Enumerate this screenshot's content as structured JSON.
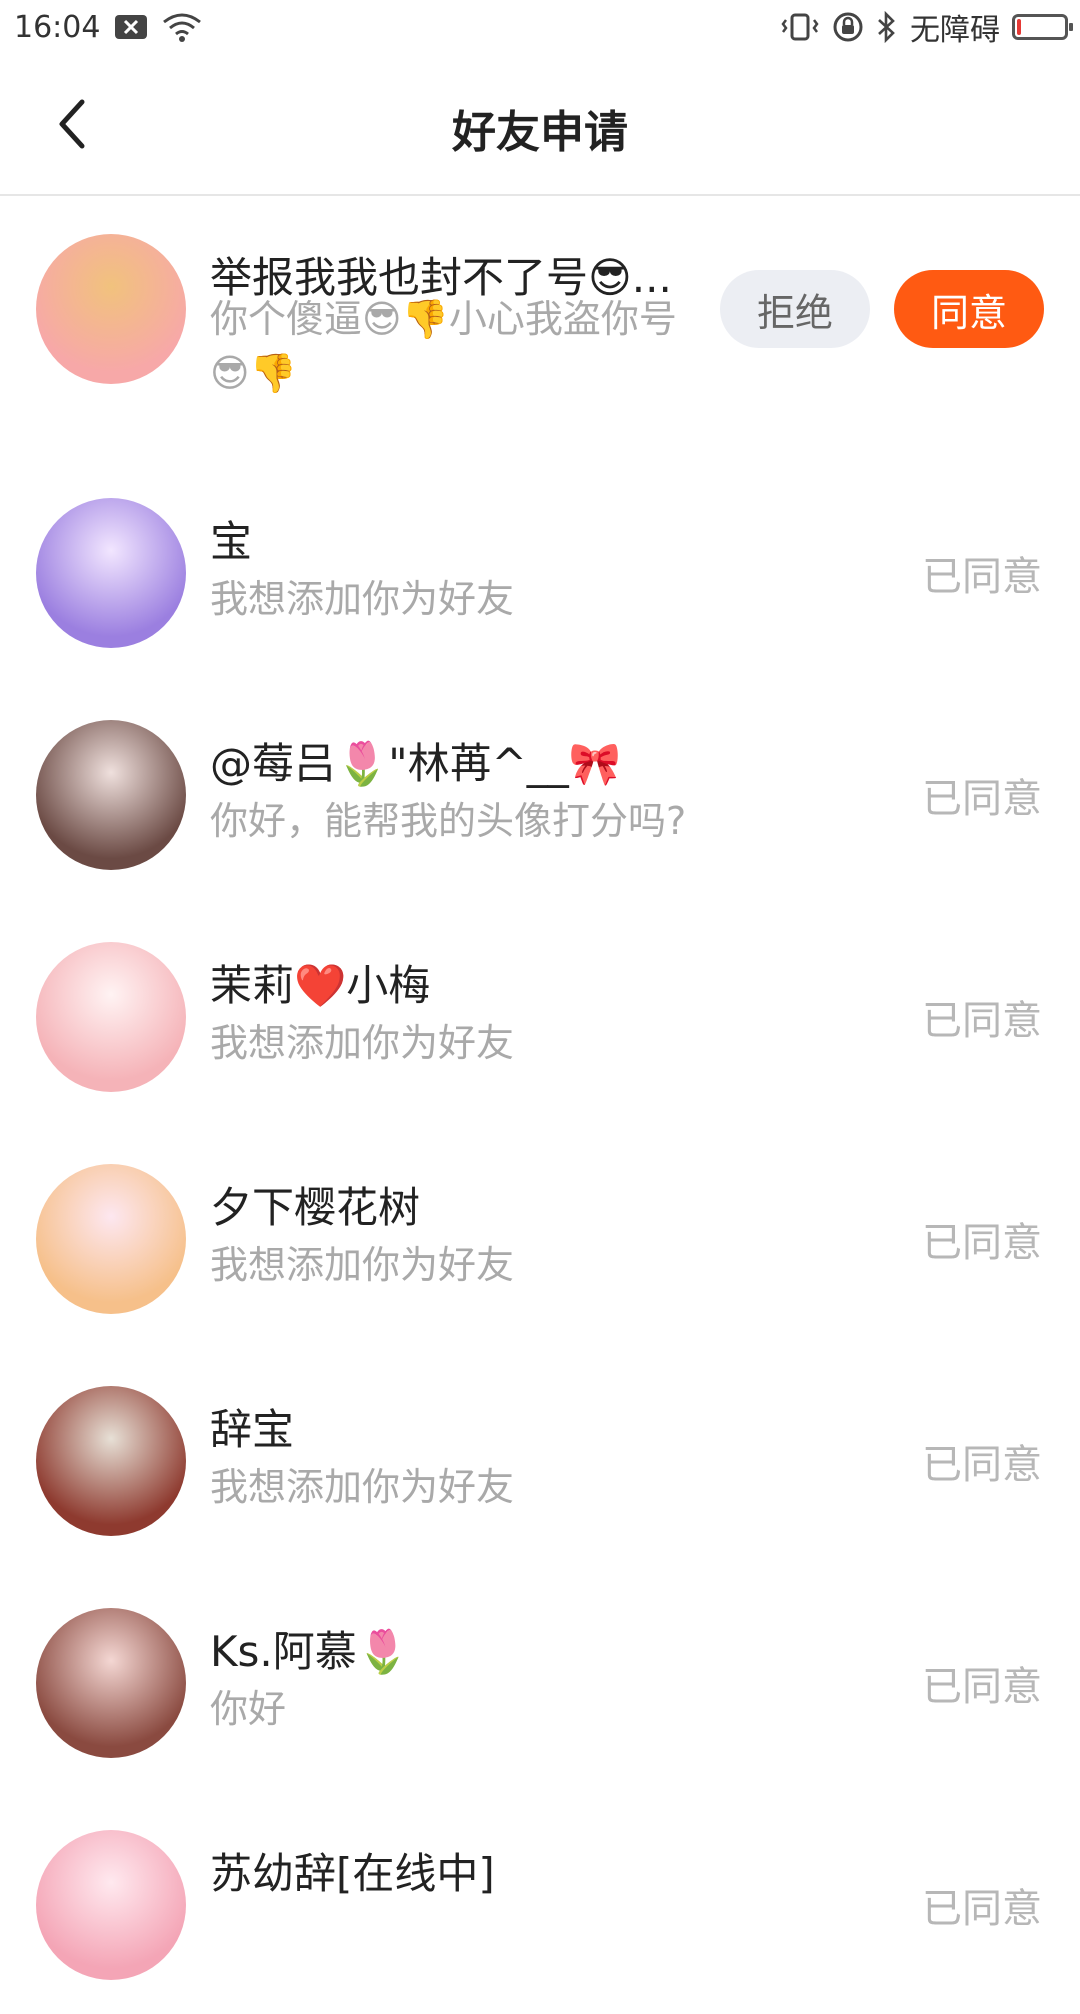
{
  "status_bar": {
    "time": "16:04",
    "accessibility": "无障碍",
    "icons": [
      "close-box-icon",
      "wifi-icon",
      "vibrate-icon",
      "rotation-lock-icon",
      "bluetooth-icon",
      "battery-icon"
    ],
    "battery_level": 0.08
  },
  "nav": {
    "title": "好友申请",
    "back_icon": "chevron-left-icon"
  },
  "colors": {
    "accent": "#ff5a12",
    "reject_bg": "#eceef3",
    "muted_text": "#a9a9a9",
    "status_text": "#b7b7b7"
  },
  "requests": [
    {
      "name": "举报我我也封不了号😎...",
      "message": "你个傻逼😎👎小心我盗你号😎👎",
      "reject_label": "拒绝",
      "accept_label": "同意",
      "avatar_colors": [
        "#f7a8a8",
        "#f1c27d"
      ]
    },
    {
      "name": "宝",
      "message": "我想添加你为好友",
      "status": "已同意",
      "avatar_colors": [
        "#9b7fe0",
        "#f2e6ff"
      ]
    },
    {
      "name": "@莓吕🌷\"林苒^__🎀",
      "message": "你好，能帮我的头像打分吗?",
      "status": "已同意",
      "avatar_colors": [
        "#6b4a44",
        "#efe0dd"
      ]
    },
    {
      "name": "茉莉❤️小梅",
      "message": "我想添加你为好友",
      "status": "已同意",
      "avatar_colors": [
        "#f5b3b8",
        "#fff3f3"
      ]
    },
    {
      "name": "夕下樱花树",
      "message": "我想添加你为好友",
      "status": "已同意",
      "avatar_colors": [
        "#f6c08a",
        "#fde7f0"
      ]
    },
    {
      "name": "辞宝",
      "message": "我想添加你为好友",
      "status": "已同意",
      "avatar_colors": [
        "#8e3a2f",
        "#e7e0d6"
      ]
    },
    {
      "name": "Ks.阿慕🌷",
      "message": "你好",
      "status": "已同意",
      "avatar_colors": [
        "#8a4a40",
        "#f4d7d3"
      ]
    },
    {
      "name": "苏幼辞[在线中]",
      "message": "",
      "status": "已同意",
      "avatar_colors": [
        "#f4a5b6",
        "#ffe9ef"
      ]
    }
  ]
}
